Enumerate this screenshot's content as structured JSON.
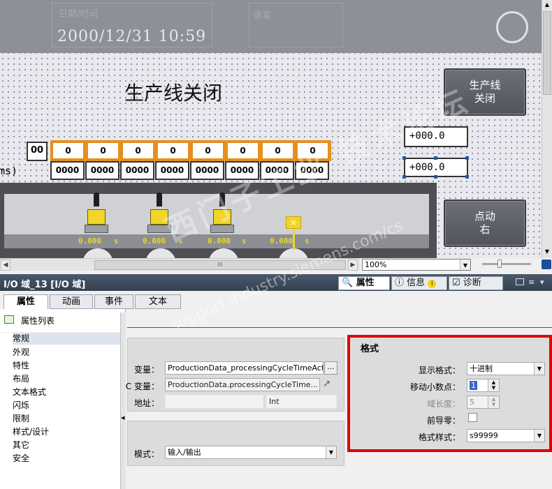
{
  "hmi": {
    "date_label": "日期/时间",
    "language_label": "语言",
    "datetime": "2000/12/31 10:59",
    "title": "生产线关闭",
    "btn_close_line": "生产线\n关闭",
    "btn_jog_right": "点动\n右",
    "io_field_1": "+000.0",
    "io_field_2": "+000.0",
    "row_index": "00",
    "ms_label": "ms)",
    "row_top": [
      "0",
      "0",
      "0",
      "0",
      "0",
      "0",
      "0",
      "0"
    ],
    "row_bottom": [
      "0000",
      "0000",
      "0000",
      "0000",
      "0000",
      "0000",
      "0000",
      "0000"
    ],
    "timers": [
      {
        "value": "0.000",
        "unit": "s"
      },
      {
        "value": "0.000",
        "unit": "s"
      },
      {
        "value": "0.000",
        "unit": "s"
      },
      {
        "value": "0.000",
        "unit": "s"
      }
    ]
  },
  "scroll": {
    "zoom": "100%",
    "hscroll_grip": "III"
  },
  "inspector": {
    "object_title": "I/O 域_13 [I/O 域]",
    "tabs": [
      {
        "label": "属性",
        "icon": "properties-icon",
        "active": true
      },
      {
        "label": "信息",
        "icon": "info-icon",
        "active": false
      },
      {
        "label": "诊断",
        "icon": "diagnostics-icon",
        "active": false
      }
    ],
    "subtabs": [
      {
        "label": "属性",
        "active": true
      },
      {
        "label": "动画",
        "active": false
      },
      {
        "label": "事件",
        "active": false
      },
      {
        "label": "文本",
        "active": false
      }
    ],
    "property_list_label": "属性列表",
    "tree": [
      "常规",
      "外观",
      "特性",
      "布局",
      "文本格式",
      "闪烁",
      "限制",
      "样式/设计",
      "其它",
      "安全"
    ],
    "selected_tree": "常规",
    "process": {
      "var_label": "变量：",
      "var_value": "ProductionData_processingCycleTimeAct",
      "var_button": "...",
      "plc_var_label": "C 变量：",
      "plc_var_value": "ProductionData.processingCycleTime...",
      "addr_label": "地址：",
      "addr_value": "",
      "type_value": "Int"
    },
    "mode": {
      "label": "模式：",
      "value": "输入/输出"
    },
    "format": {
      "title": "格式",
      "display_format_label": "显示格式：",
      "display_format_value": "十进制",
      "decimal_shift_label": "移动小数点：",
      "decimal_shift_value": "1",
      "field_length_label": "域长度：",
      "field_length_value": "5",
      "leading_zero_label": "前导零：",
      "leading_zero_checked": false,
      "format_pattern_label": "格式样式：",
      "format_pattern_value": "s99999"
    }
  },
  "watermark": {
    "line1": "西门子工业 技术论坛",
    "line2": "support.industry.siemens.com/cs"
  },
  "colors": {
    "accent_red": "#e10000",
    "io_orange": "#e5901c",
    "timer_yellow": "#e6d630",
    "inspector_bar": "#3a4757"
  }
}
